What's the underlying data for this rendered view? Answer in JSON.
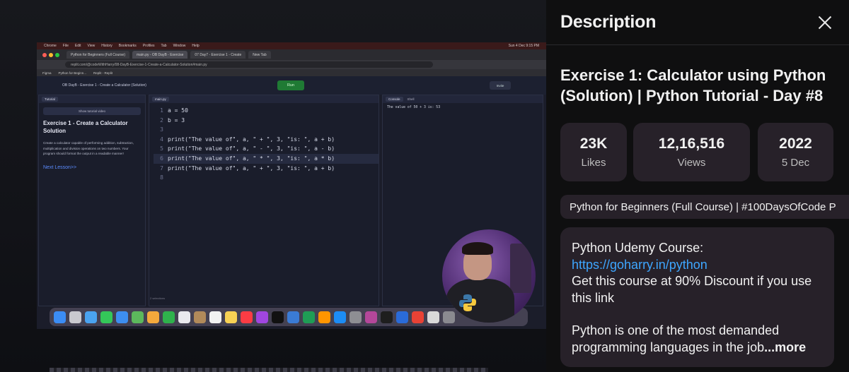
{
  "video": {
    "mac_menubar": {
      "items": [
        "Chrome",
        "File",
        "Edit",
        "View",
        "History",
        "Bookmarks",
        "Profiles",
        "Tab",
        "Window",
        "Help"
      ],
      "clock": "Sun 4 Dec 9:15 PM"
    },
    "browser": {
      "tabs": [
        "Python for Beginners (Full Course)",
        "main.py - OB DayB - Exercise",
        "07 Day7 - Exercise 1 - Create",
        "New Tab"
      ],
      "url": "replit.com/@codeWithHarry/08-DayB-Exercise-1-Create-a-Calculator-Solution#main.py",
      "bookmarks": [
        "Figma",
        "Python for Beginn...",
        "Replit - Replit"
      ]
    },
    "replit": {
      "project_title": "OB DayB - Exercise 1 - Create a Calculator (Solution)",
      "run_label": "Run",
      "invite_label": "Invite",
      "tutorial_tab": "Tutorial",
      "editor_tab": "main.py",
      "console_tab": "Console",
      "shell_tab": "Shell",
      "show_video": "Show tutorial video",
      "tutorial_title": "Exercise 1 - Create a Calculator Solution",
      "tutorial_body": "Create a calculator capable of performing addition, subtraction, multiplication and division operations on two numbers. Your program should format the output in a readable manner!",
      "next_lesson": "Next Lesson>>",
      "code_lines": [
        {
          "n": "1",
          "text": "a = 50"
        },
        {
          "n": "2",
          "text": "b = 3"
        },
        {
          "n": "3",
          "text": ""
        },
        {
          "n": "4",
          "text": "print(\"The value of\", a, \" + \", 3, \"is: \", a + b)"
        },
        {
          "n": "5",
          "text": "print(\"The value of\", a, \" - \", 3, \"is: \", a - b)"
        },
        {
          "n": "6",
          "text": "print(\"The value of\", a, \" * \", 3, \"is: \", a * b)"
        },
        {
          "n": "7",
          "text": "print(\"The value of\", a, \" + \", 3, \"is: \", a + b)"
        },
        {
          "n": "8",
          "text": ""
        }
      ],
      "console_output": "The value of 50 + 3 is: 53",
      "status": "2 selections"
    }
  },
  "panel": {
    "header_title": "Description",
    "video_title": "Exercise 1: Calculator using Python (Solution) | Python Tutorial - Day #8",
    "stats": {
      "likes": {
        "value": "23K",
        "label": "Likes"
      },
      "views": {
        "value": "12,16,516",
        "label": "Views"
      },
      "date": {
        "value": "2022",
        "label": "5 Dec"
      }
    },
    "playlist": "Python for Beginners (Full Course) | #100DaysOfCode P",
    "description": {
      "line1_prefix": "Python Udemy Course: ",
      "link": "https://goharry.in/python",
      "line2": "Get this course at 90% Discount if you use this link",
      "line3": "Python is one of the most demanded programming languages in the job",
      "more": "...more"
    },
    "colors": {
      "background": "#0f0f10",
      "card": "#272129",
      "link": "#3ea6ff",
      "text": "#f1f1f1"
    }
  }
}
